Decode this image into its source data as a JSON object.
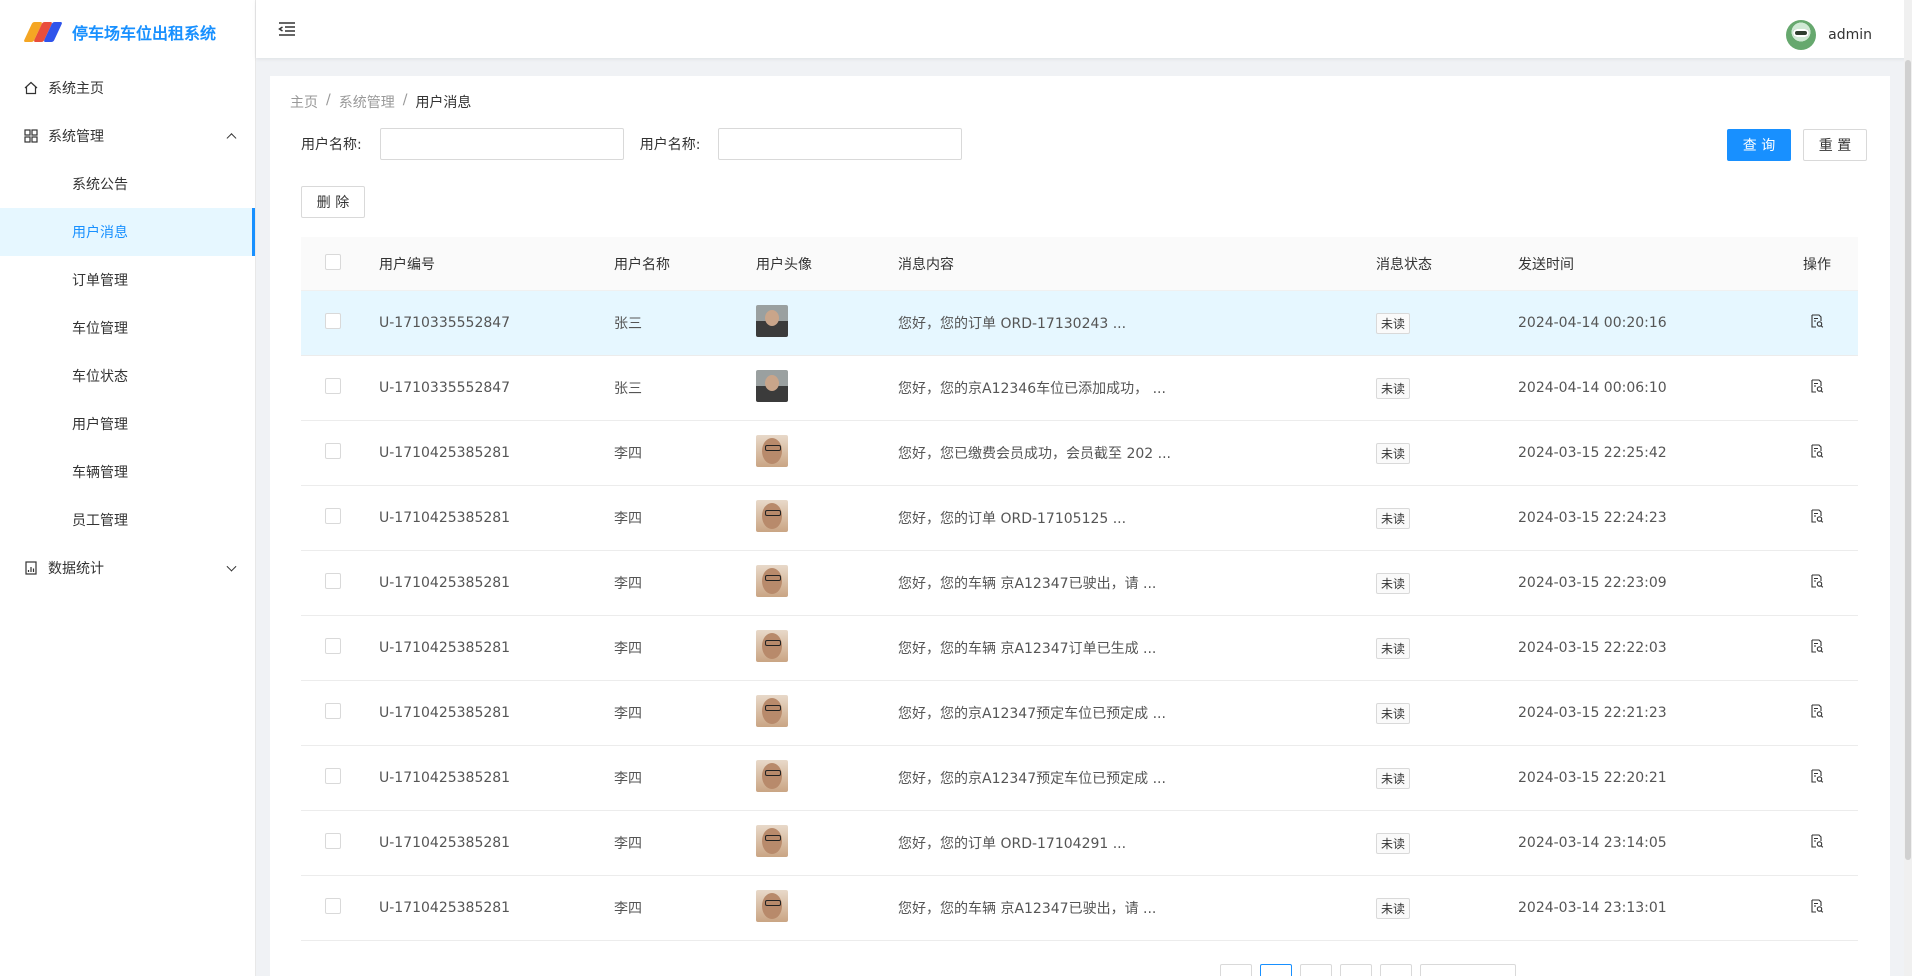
{
  "app": {
    "title": "停车场车位出租系统"
  },
  "header": {
    "username": "admin"
  },
  "sidebar": {
    "home": "系统主页",
    "system_mgmt": "系统管理",
    "sub_items": [
      "系统公告",
      "用户消息",
      "订单管理",
      "车位管理",
      "车位状态",
      "用户管理",
      "车辆管理",
      "员工管理"
    ],
    "stats": "数据统计"
  },
  "breadcrumb": {
    "home": "主页",
    "level1": "系统管理",
    "current": "用户消息",
    "sep": "/"
  },
  "search": {
    "label1": "用户名称:",
    "label2": "用户名称:",
    "query_label": "查 询",
    "reset_label": "重 置",
    "delete_label": "删 除"
  },
  "table": {
    "headers": [
      "用户编号",
      "用户名称",
      "用户头像",
      "消息内容",
      "消息状态",
      "发送时间",
      "操作"
    ],
    "rows": [
      {
        "id": "U-1710335552847",
        "name": "张三",
        "avatar": "zhang",
        "msg": "您好，您的订单 ORD-17130243 ...",
        "status": "未读",
        "time": "2024-04-14 00:20:16"
      },
      {
        "id": "U-1710335552847",
        "name": "张三",
        "avatar": "zhang",
        "msg": "您好，您的京A12346车位已添加成功，  ...",
        "status": "未读",
        "time": "2024-04-14 00:06:10"
      },
      {
        "id": "U-1710425385281",
        "name": "李四",
        "avatar": "li",
        "msg": "您好，您已缴费会员成功，会员截至 202 ...",
        "status": "未读",
        "time": "2024-03-15 22:25:42"
      },
      {
        "id": "U-1710425385281",
        "name": "李四",
        "avatar": "li",
        "msg": "您好，您的订单 ORD-17105125 ...",
        "status": "未读",
        "time": "2024-03-15 22:24:23"
      },
      {
        "id": "U-1710425385281",
        "name": "李四",
        "avatar": "li",
        "msg": "您好，您的车辆 京A12347已驶出，请 ...",
        "status": "未读",
        "time": "2024-03-15 22:23:09"
      },
      {
        "id": "U-1710425385281",
        "name": "李四",
        "avatar": "li",
        "msg": "您好，您的车辆 京A12347订单已生成 ...",
        "status": "未读",
        "time": "2024-03-15 22:22:03"
      },
      {
        "id": "U-1710425385281",
        "name": "李四",
        "avatar": "li",
        "msg": "您好，您的京A12347预定车位已预定成 ...",
        "status": "未读",
        "time": "2024-03-15 22:21:23"
      },
      {
        "id": "U-1710425385281",
        "name": "李四",
        "avatar": "li",
        "msg": "您好，您的京A12347预定车位已预定成 ...",
        "status": "未读",
        "time": "2024-03-15 22:20:21"
      },
      {
        "id": "U-1710425385281",
        "name": "李四",
        "avatar": "li",
        "msg": "您好，您的订单 ORD-17104291 ...",
        "status": "未读",
        "time": "2024-03-14 23:14:05"
      },
      {
        "id": "U-1710425385281",
        "name": "李四",
        "avatar": "li",
        "msg": "您好，您的车辆 京A12347已驶出，请 ...",
        "status": "未读",
        "time": "2024-03-14 23:13:01"
      }
    ]
  },
  "colors": {
    "primary": "#1890ff",
    "active_bg": "#e6f7ff"
  }
}
